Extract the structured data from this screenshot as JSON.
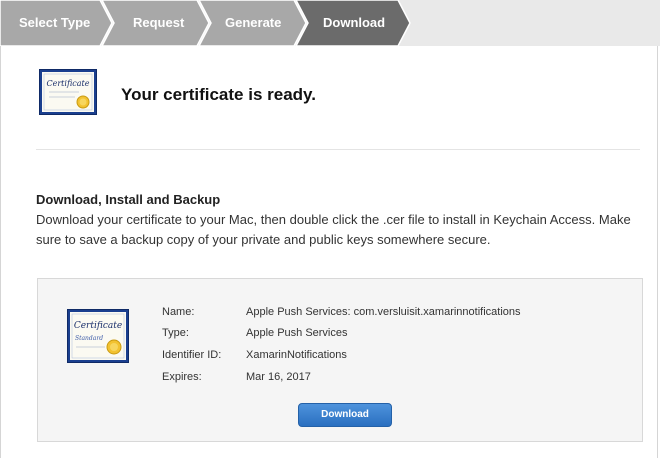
{
  "steps": [
    {
      "label": "Select Type"
    },
    {
      "label": "Request"
    },
    {
      "label": "Generate"
    },
    {
      "label": "Download"
    }
  ],
  "header": {
    "title": "Your certificate is ready.",
    "icon": "certificate-icon"
  },
  "section": {
    "heading": "Download, Install and Backup",
    "body": "Download your certificate to your Mac, then double click the .cer file to install in Keychain Access. Make sure to save a backup copy of your private and public keys somewhere secure."
  },
  "certificate": {
    "icon": "certificate-standard-icon",
    "name_label": "Name:",
    "name_value": "Apple Push Services: com.versluisit.xamarinnotifications",
    "type_label": "Type:",
    "type_value": "Apple Push Services",
    "identifier_label": "Identifier ID:",
    "identifier_value": "XamarinNotifications",
    "expires_label": "Expires:",
    "expires_value": "Mar 16, 2017",
    "download_label": "Download"
  },
  "colors": {
    "step_inactive": "#a7a7a7",
    "step_active": "#6a6a6a",
    "button": "#2f78c8",
    "seal": "#f2c230"
  }
}
